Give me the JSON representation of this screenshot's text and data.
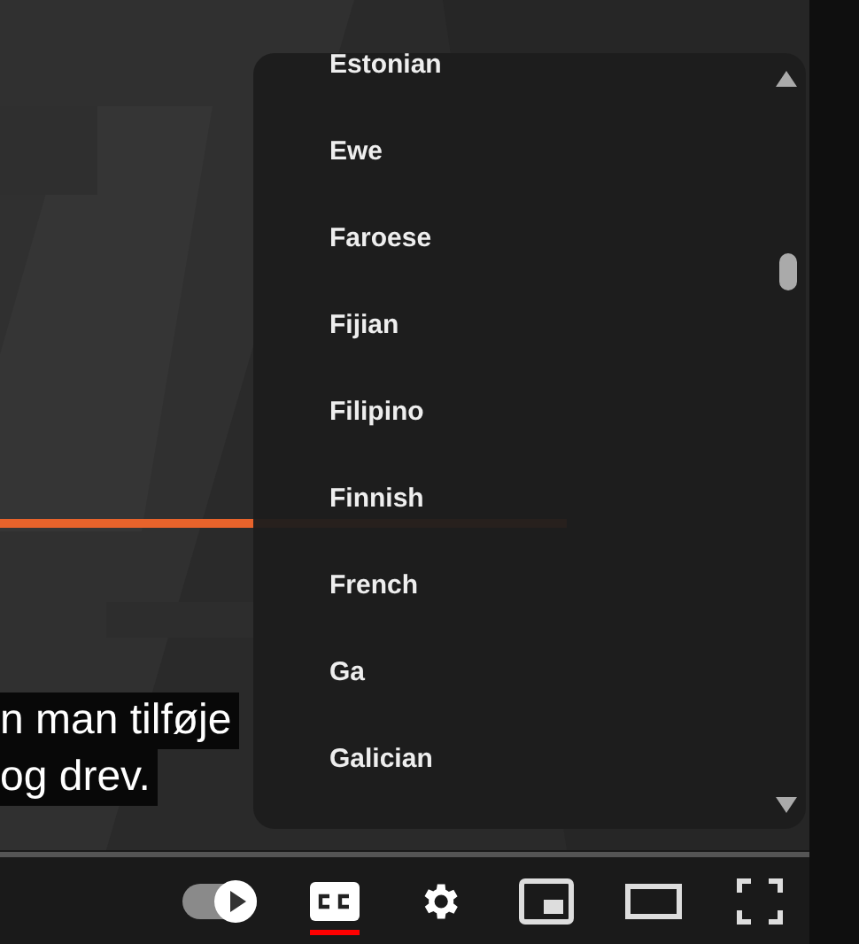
{
  "captions": [
    {
      "text": "n man tilføje"
    },
    {
      "text": "og drev."
    }
  ],
  "language_menu": {
    "items": [
      {
        "label": "Estonian"
      },
      {
        "label": "Ewe"
      },
      {
        "label": "Faroese"
      },
      {
        "label": "Fijian"
      },
      {
        "label": "Filipino"
      },
      {
        "label": "Finnish"
      },
      {
        "label": "French"
      },
      {
        "label": "Ga"
      },
      {
        "label": "Galician"
      }
    ]
  },
  "controls": {
    "autoplay": {
      "on": true
    },
    "subtitles": {
      "selected": true
    }
  }
}
